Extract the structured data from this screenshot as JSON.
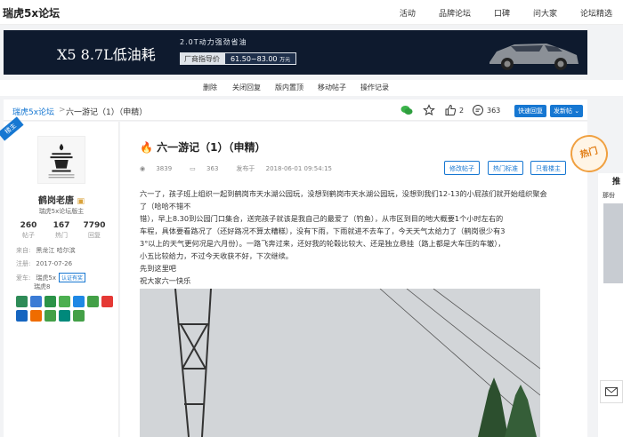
{
  "site": {
    "brand": "瑞虎5x论坛",
    "nav": [
      "活动",
      "品牌论坛",
      "口碑",
      "问大家",
      "论坛精选"
    ]
  },
  "banner": {
    "headline": "X5 8.7L低油耗",
    "sub": "2.0T动力强劲省油",
    "guide_label": "厂商指导价",
    "guide_value": "61.50~83.00",
    "guide_unit": "万元"
  },
  "admin_tools": [
    "删除",
    "关闭回复",
    "版内置顶",
    "移动帖子",
    "操作记录"
  ],
  "breadcrumb": {
    "forum": "瑞虎5x论坛",
    "separator": ">",
    "current": "六一游记（1）（申精）",
    "likes": "2",
    "comments": "363",
    "reply_button": "快速回复",
    "newpost_button": "发新帖"
  },
  "author": {
    "ribbon": "楼主",
    "name": "鹤岗老唐",
    "role": "瑞虎5x论坛版主",
    "stats": [
      {
        "value": "260",
        "label": "帖子"
      },
      {
        "value": "167",
        "label": "热门"
      },
      {
        "value": "7790",
        "label": "回复"
      }
    ],
    "from_label": "来自:",
    "from_value": "黑龙江 哈尔滨",
    "reg_label": "注册:",
    "reg_value": "2017-07-26",
    "car_label": "爱车:",
    "car_value": "瑞虎5x",
    "car_cert": "认证有奖",
    "car_value2": "瑞虎8",
    "badge_colors": [
      "#2e8b57",
      "#3a7bd5",
      "#2b9348",
      "#4caf50",
      "#1e88e5",
      "#43a047",
      "#e53935",
      "#1565c0",
      "#ef6c00",
      "#43a047",
      "#00897b",
      "#43a047"
    ]
  },
  "post": {
    "title": "六一游记（1）（申精）",
    "views": "3839",
    "replies": "363",
    "published_label": "发布于",
    "published": "2018-06-01 09:54:15",
    "btn_edit": "修改帖子",
    "btn_hot": "热门标准",
    "btn_owner": "只看楼主",
    "body": [
      "六一了，孩子班上组织一起到鹤岗市天水湖公园玩，没想到鹤岗市天水湖公园玩，没想到我们12-13的小屁孩们就开始组织聚会了（哈哈不错不",
      "错），早上8.30到公园门口集合，送完孩子就该是我自己的最爱了（钓鱼），从市区到目的地大概要1个小时左右的",
      "车程，具体要看路况了（还好路况不算太糟糕），没有下雨，下雨就进不去车了，今天天气太给力了（鹤岗很少有3",
      "3°以上的天气更何况是六月份）。一路飞奔过来，还好我的轮毂比较大、还是独立悬挂（路上都是大车压的车辙），",
      "小五比较给力，不过今天收获不好，下次继续。",
      "先到这里吧",
      "祝大家六一快乐"
    ]
  },
  "hot_badge": "热门",
  "right_panel": {
    "title": "推",
    "snippet": "那份"
  }
}
